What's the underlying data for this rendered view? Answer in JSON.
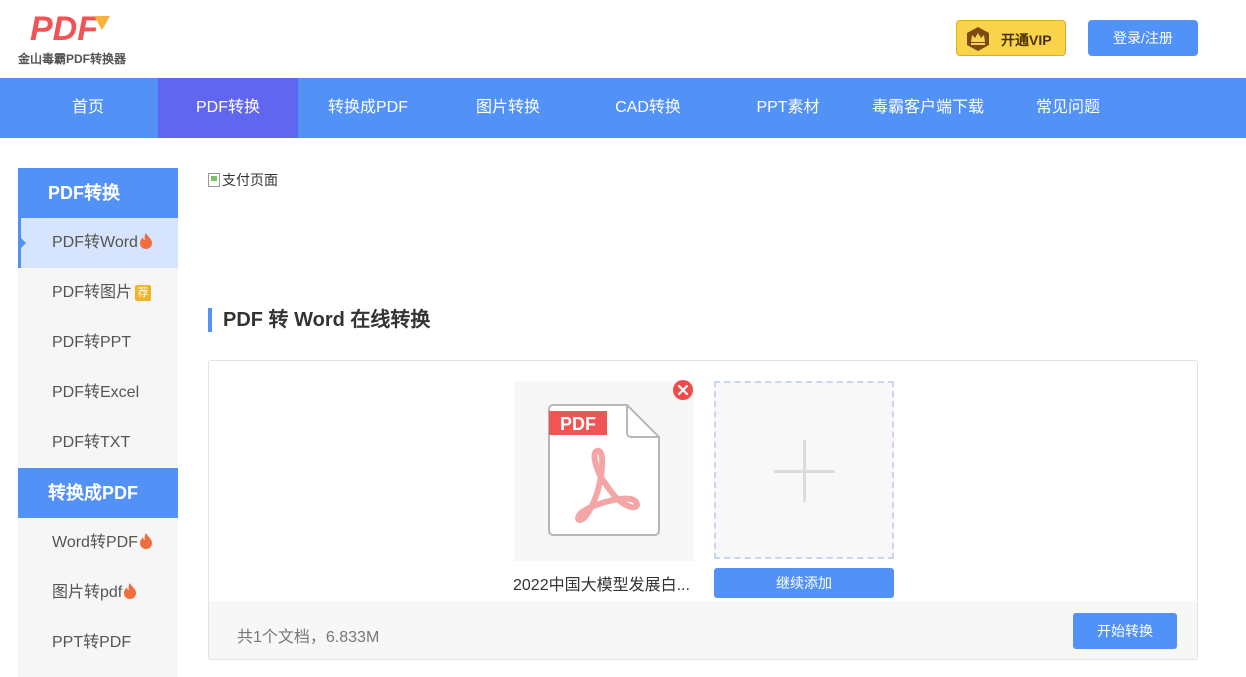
{
  "header": {
    "logo_mark": "PDF",
    "logo_text": "金山毒霸PDF转换器",
    "vip_label": "开通VIP",
    "login_label": "登录/注册"
  },
  "nav": {
    "items": [
      {
        "label": "首页"
      },
      {
        "label": "PDF转换",
        "active": true
      },
      {
        "label": "转换成PDF"
      },
      {
        "label": "图片转换"
      },
      {
        "label": "CAD转换"
      },
      {
        "label": "PPT素材"
      },
      {
        "label": "毒霸客户端下载"
      },
      {
        "label": "常见问题"
      }
    ]
  },
  "sidebar": {
    "group1": {
      "title": "PDF转换",
      "items": [
        {
          "label": "PDF转Word",
          "hot": true,
          "active": true
        },
        {
          "label": "PDF转图片",
          "badge": "荐"
        },
        {
          "label": "PDF转PPT"
        },
        {
          "label": "PDF转Excel"
        },
        {
          "label": "PDF转TXT"
        }
      ]
    },
    "group2": {
      "title": "转换成PDF",
      "items": [
        {
          "label": "Word转PDF",
          "hot": true
        },
        {
          "label": "图片转pdf",
          "hot": true
        },
        {
          "label": "PPT转PDF"
        }
      ]
    }
  },
  "main": {
    "banner_alt": "支付页面",
    "section_title": "PDF 转 Word 在线转换",
    "file": {
      "type_label": "PDF",
      "name": "2022中国大模型发展白..."
    },
    "add_more_label": "继续添加",
    "summary": "共1个文档，6.833M",
    "start_label": "开始转换"
  },
  "colors": {
    "primary": "#5292f7",
    "nav_active": "#6166f0",
    "logo_red": "#f05454",
    "vip_gold": "#f9d44a",
    "remove_red": "#ee4b4b"
  }
}
